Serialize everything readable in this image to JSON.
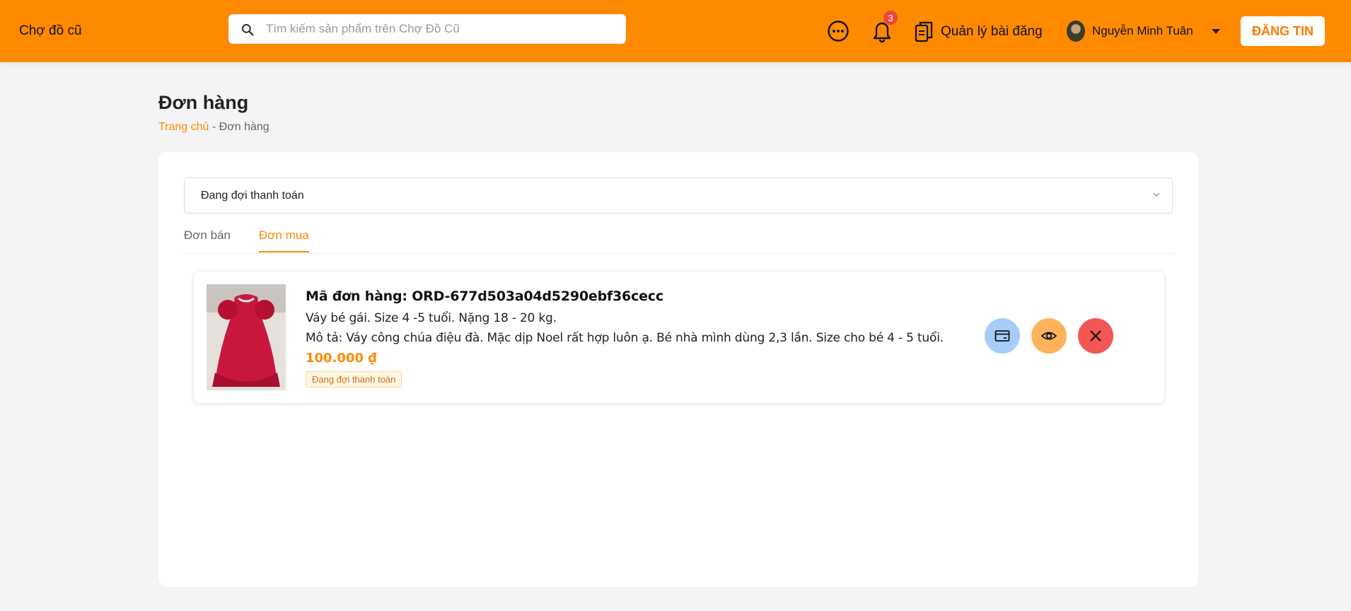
{
  "header": {
    "logo": "Chợ đồ cũ",
    "search_placeholder": "Tìm kiếm sản phẩm trên Chợ Đồ Cũ",
    "notification_count": "3",
    "manage_posts": "Quản lý bài đăng",
    "user_name": "Nguyễn Minh Tuân",
    "post_button": "ĐĂNG TIN",
    "brand_color": "#ff8a00"
  },
  "page": {
    "title": "Đơn hàng",
    "breadcrumb_home": "Trang chủ",
    "breadcrumb_sep": " - ",
    "breadcrumb_current": "Đơn hàng"
  },
  "filter": {
    "selected": "Đang đợi thanh toán"
  },
  "tabs": [
    {
      "label": "Đơn bán",
      "active": false
    },
    {
      "label": "Đơn mua",
      "active": true
    }
  ],
  "orders": [
    {
      "id_label": "Mã đơn hàng: ORD-677d503a04d5290ebf36cecc",
      "title": "Váy bé gái. Size 4 -5 tuổi. Nặng 18 - 20 kg.",
      "description": "Mô tả: Váy công chúa điệu đà. Mặc dịp Noel rất hợp luôn ạ. Bé nhà mình dùng 2,3 lần. Size cho bé 4 - 5 tuổi.",
      "price": "100.000 ₫",
      "status": "Đang đợi thanh toán",
      "actions": [
        "payment-icon",
        "eye-icon",
        "close-icon"
      ]
    }
  ]
}
